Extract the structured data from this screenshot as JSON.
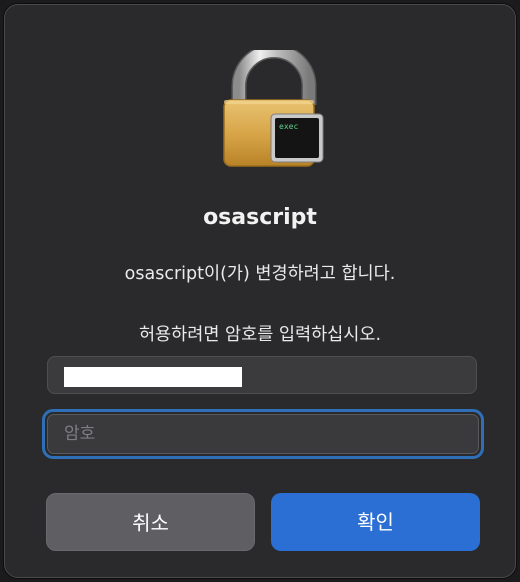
{
  "dialog": {
    "app_icon": "padlock-exec-icon",
    "icon_badge_text": "exec",
    "title": "osascript",
    "message": "osascript이(가) 변경하려고 합니다.",
    "prompt": "허용하려면 암호를 입력하십시오.",
    "username_value": "",
    "password_placeholder": "암호",
    "cancel_label": "취소",
    "ok_label": "확인"
  },
  "colors": {
    "accent": "#2b6fd4",
    "focus_ring": "#2f6fb7",
    "background": "#2a2a2c"
  }
}
